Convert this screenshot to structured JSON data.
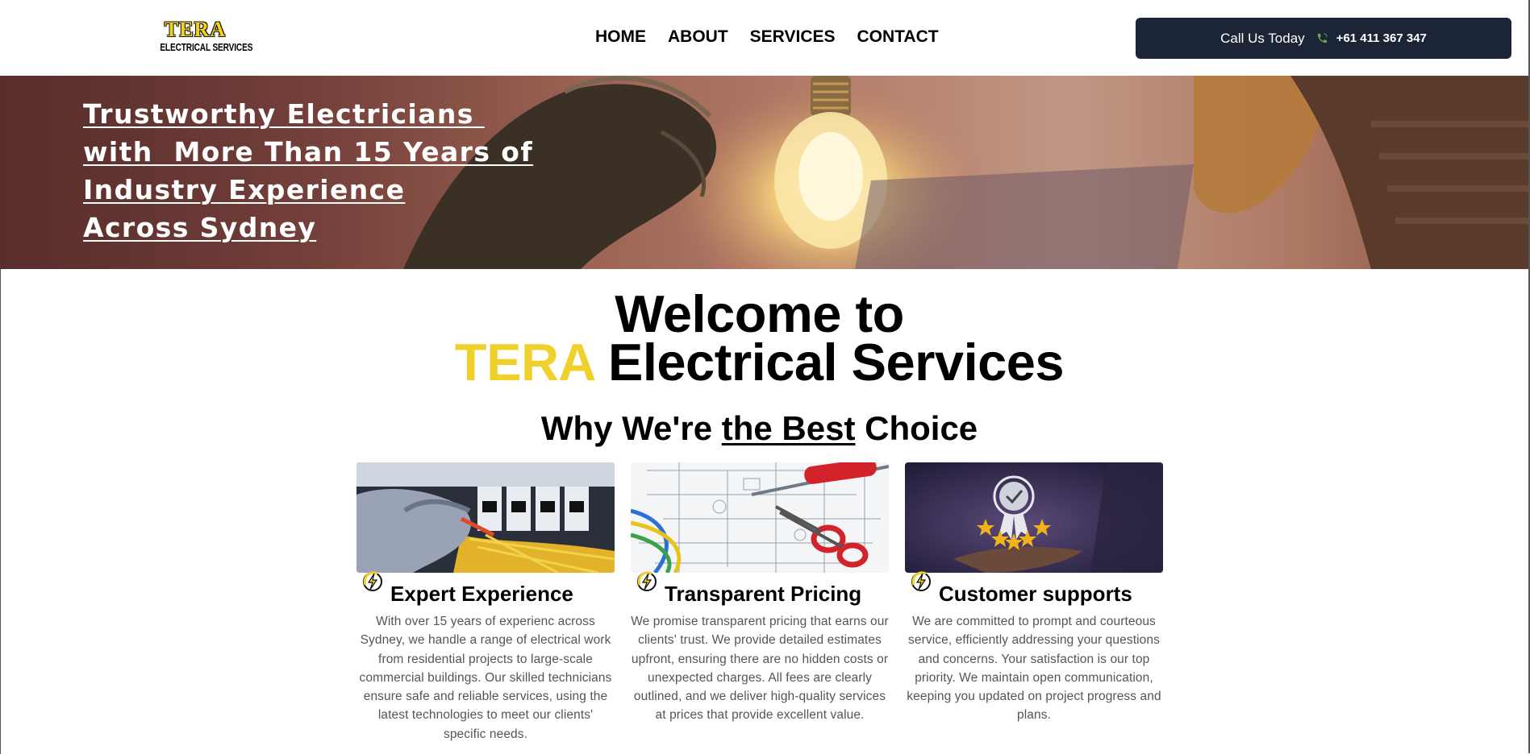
{
  "header": {
    "logo": {
      "wordmark": "TERA",
      "subtitle": "ELECTRICAL SERVICES"
    },
    "nav": [
      {
        "label": "HOME"
      },
      {
        "label": "ABOUT"
      },
      {
        "label": "SERVICES"
      },
      {
        "label": "CONTACT"
      }
    ],
    "call": {
      "label": "Call Us Today",
      "number": "+61 411 367 347",
      "icon": "phone-icon"
    }
  },
  "hero": {
    "lines": [
      "Trustworthy Electricians ",
      "with  More Than 15 Years of",
      "Industry Experience",
      "Across Sydney"
    ]
  },
  "welcome": {
    "line1": "Welcome to",
    "brand": "TERA",
    "rest": " Electrical Services"
  },
  "why": {
    "before": "Why We're ",
    "emphasis": "the Best",
    "after": " Choice"
  },
  "cards": [
    {
      "icon": "lightning-bolt-icon",
      "image": "electrician-testing-panel",
      "title": "Expert Experience",
      "text": "With over 15 years of experienc across Sydney, we handle a range of electrical work from residential projects to large-scale commercial buildings. Our skilled technicians ensure safe and reliable services, using the latest technologies to meet our clients' specific needs."
    },
    {
      "icon": "lightning-bolt-icon",
      "image": "wiring-blueprint-tools",
      "title": "Transparent Pricing",
      "text": "We promise transparent pricing that earns our clients' trust. We provide detailed estimates upfront, ensuring there are no hidden costs or unexpected charges. All fees are clearly outlined, and we deliver high-quality services at prices that provide excellent value."
    },
    {
      "icon": "lightning-bolt-icon",
      "image": "award-badge-stars",
      "title": "Customer supports",
      "text": "We are committed to prompt and courteous service, efficiently addressing your questions and concerns. Your satisfaction is our top priority. We maintain open communication, keeping you updated on project progress and plans."
    }
  ],
  "colors": {
    "brand_yellow": "#f0d02a",
    "button_navy": "#1b2537",
    "body_text": "#555555"
  }
}
